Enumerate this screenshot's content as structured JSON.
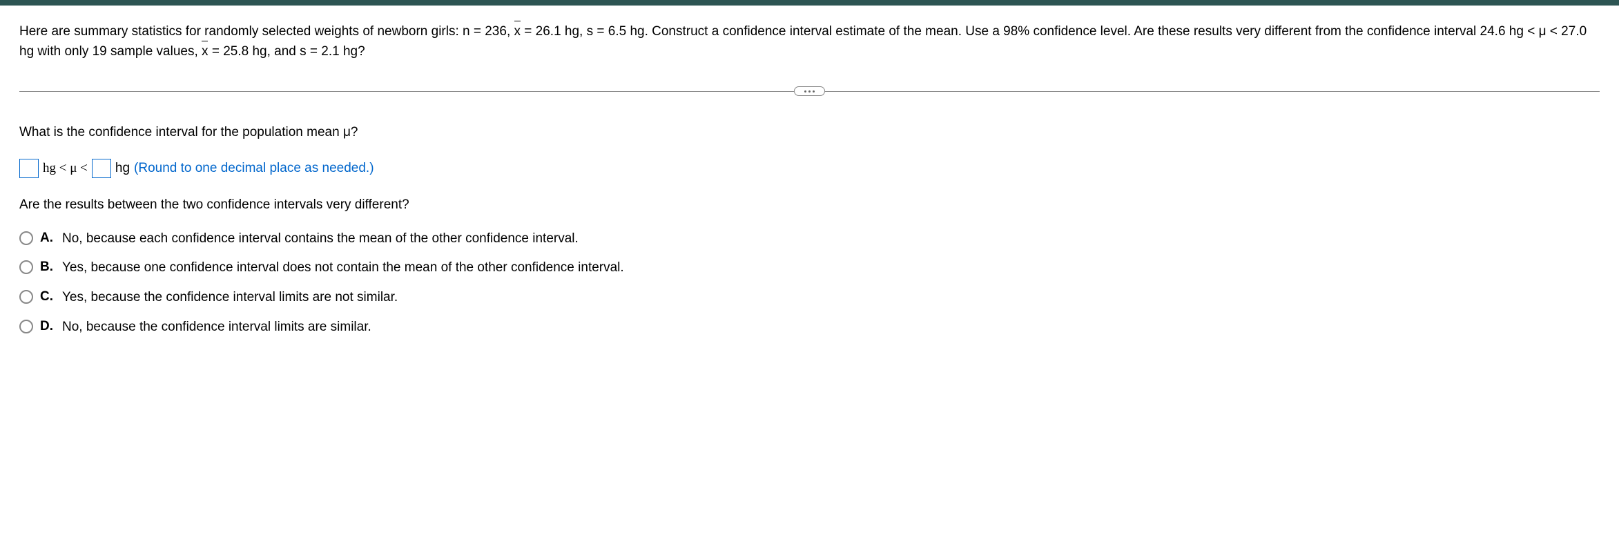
{
  "question": {
    "intro": "Here are summary statistics for randomly selected weights of newborn girls: n = 236, ",
    "xbar1": "x",
    "part1b": " = 26.1 hg, s = 6.5 hg. Construct a confidence interval estimate of the mean. Use a 98% confidence level. Are these results very different from the confidence interval 24.6 hg < μ < 27.0 hg with only 19 sample values, ",
    "xbar2": "x",
    "part1c": " = 25.8 hg, and s = 2.1 hg?"
  },
  "sub_q1": "What is the confidence interval for the population mean μ?",
  "answer_row": {
    "seg1": "hg < μ <",
    "seg2": "hg",
    "hint": "(Round to one decimal place as needed.)"
  },
  "sub_q2": "Are the results between the two confidence intervals very different?",
  "options": [
    {
      "letter": "A.",
      "text": "No, because each confidence interval contains the mean of the other confidence interval."
    },
    {
      "letter": "B.",
      "text": "Yes, because one confidence interval does not contain the mean of the other confidence interval."
    },
    {
      "letter": "C.",
      "text": "Yes, because the confidence interval limits are not similar."
    },
    {
      "letter": "D.",
      "text": "No, because the confidence interval limits are similar."
    }
  ]
}
